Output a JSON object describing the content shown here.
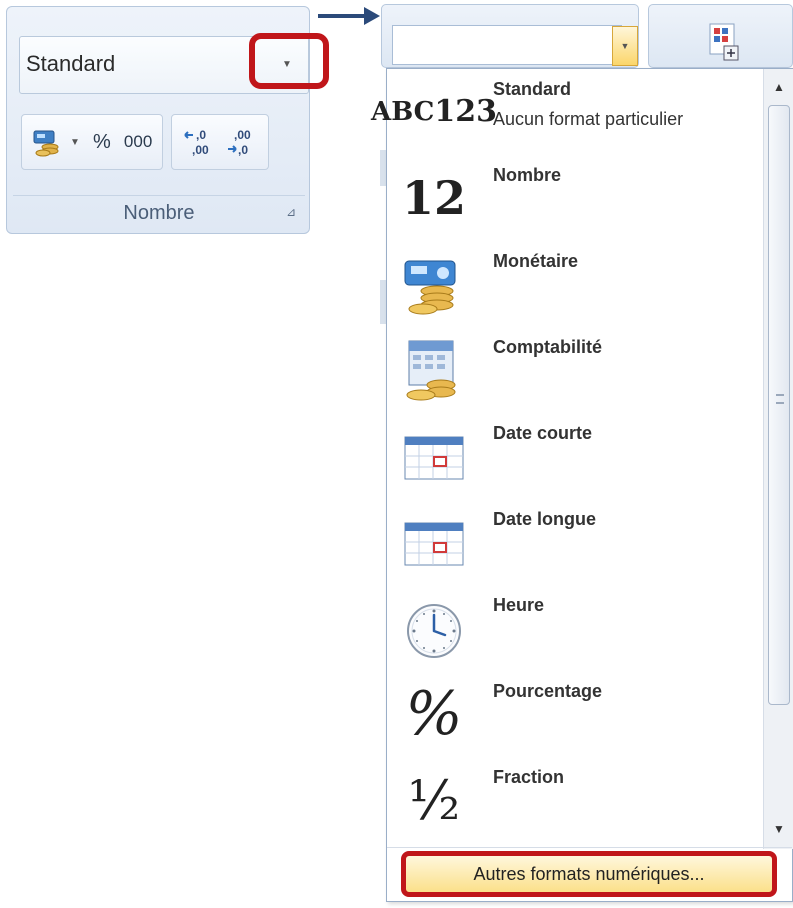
{
  "ribbon": {
    "number_format_value": "Standard",
    "percent_label": "%",
    "thousands_label": "000",
    "increase_decimal_label": ",0\n,00",
    "decrease_decimal_label": ",00\n,0",
    "group_label": "Nombre"
  },
  "dropdown": {
    "items": [
      {
        "title": "Standard",
        "subtitle": "Aucun format particulier",
        "icon": "abc-123-icon",
        "icon_text_1": "ABC",
        "icon_text_2": "123"
      },
      {
        "title": "Nombre",
        "subtitle": "",
        "icon": "number-icon",
        "icon_text_1": "12"
      },
      {
        "title": "Monétaire",
        "subtitle": "",
        "icon": "currency-icon"
      },
      {
        "title": "Comptabilité",
        "subtitle": "",
        "icon": "accounting-icon"
      },
      {
        "title": "Date courte",
        "subtitle": "",
        "icon": "calendar-icon"
      },
      {
        "title": "Date longue",
        "subtitle": "",
        "icon": "calendar-icon"
      },
      {
        "title": "Heure",
        "subtitle": "",
        "icon": "clock-icon"
      },
      {
        "title": "Pourcentage",
        "subtitle": "",
        "icon": "percent-icon",
        "icon_text_1": "%"
      },
      {
        "title": "Fraction",
        "subtitle": "",
        "icon": "fraction-icon",
        "icon_text_1": "½"
      }
    ],
    "more_formats_label": "Autres formats numériques..."
  },
  "colors": {
    "highlight_border": "#c0161a",
    "ribbon_bg": "#dfe8f4",
    "more_formats_bg": "#fbe08a"
  }
}
